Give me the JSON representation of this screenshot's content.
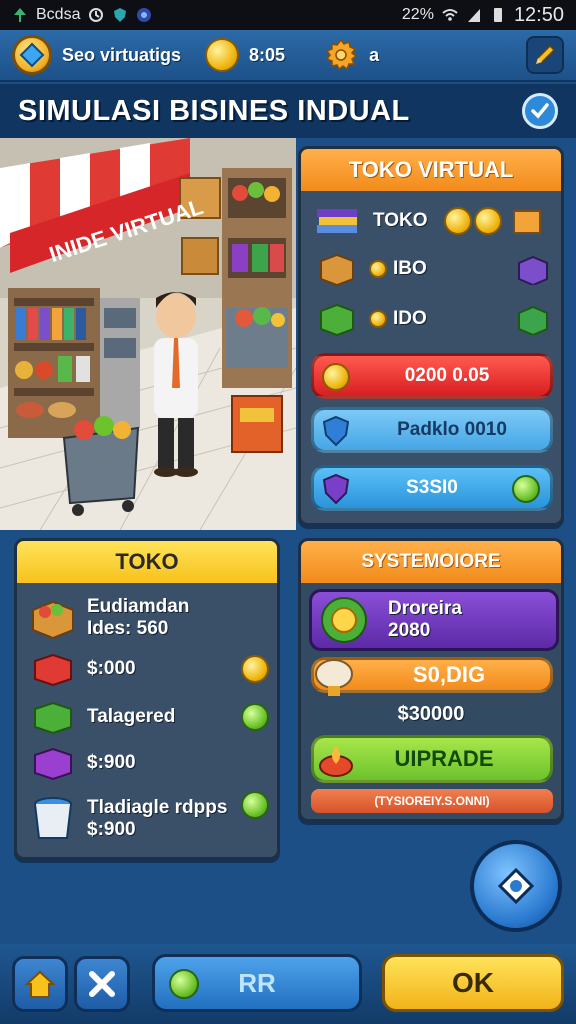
{
  "status_bar": {
    "left_text": "Bcdsa",
    "battery_text": "22%",
    "time": "12:50"
  },
  "hud": {
    "label": "Seo virtuatigs",
    "coin_value": "8:05",
    "gear_value": "a"
  },
  "title": "SIMULASI BISINES INDUAL",
  "scene": {
    "sign_text": "INIDE VIRTUAL"
  },
  "store_panel": {
    "header": "TOKO VIRTUAL",
    "rows": [
      {
        "label": "TOKO",
        "icon": "books-icon"
      },
      {
        "label": "IBO",
        "icon": "crate-icon"
      },
      {
        "label": "IDO",
        "icon": "green-box-icon"
      }
    ],
    "red_bar_text": "0200 0.05",
    "blue_bar_text": "Padklo 0010",
    "blue_bar2_text": "S3SI0"
  },
  "toko_panel": {
    "header": "TOKO",
    "items": [
      {
        "name": "Eudiamdan",
        "value": "Ides: 560",
        "icon": "produce-crate-icon"
      },
      {
        "name": "",
        "value": "$:000",
        "icon": "red-box-icon"
      },
      {
        "name": "Talagered",
        "value": "",
        "icon": "green-box-icon"
      },
      {
        "name": "",
        "value": "$:900",
        "icon": "purple-box-icon"
      },
      {
        "name": "Tladiagle rdpps",
        "value": "$:900",
        "icon": "bucket-icon"
      }
    ]
  },
  "system_panel": {
    "header": "SYSTEMOIORE",
    "purple_title": "Droreira",
    "purple_value": "2080",
    "orange_pill": "S0,DIG",
    "money_text": "$30000",
    "upgrade_label": "UIPRADE",
    "footer_text": "(TYSIOREIY.S.ONNI)"
  },
  "bottom": {
    "center_label": "RR",
    "ok_label": "OK"
  },
  "colors": {
    "background": "#1c4f86",
    "orange": "#f28b1b",
    "yellow": "#f7c21c",
    "red_bar": "#e02a2a",
    "blue_bar": "#5db8ef",
    "purple": "#6c34b4",
    "green": "#6cc32c"
  }
}
